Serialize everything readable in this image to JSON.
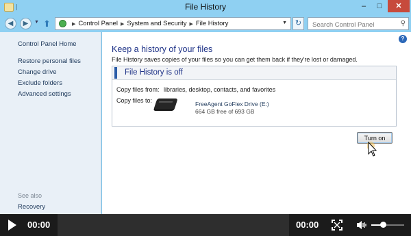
{
  "window": {
    "title": "File History",
    "controls": {
      "minimize": "–",
      "maximize": "□",
      "close": "✕"
    }
  },
  "nav": {
    "breadcrumbs": [
      "Control Panel",
      "System and Security",
      "File History"
    ],
    "search_placeholder": "Search Control Panel"
  },
  "sidebar": {
    "home": "Control Panel Home",
    "links": [
      "Restore personal files",
      "Change drive",
      "Exclude folders",
      "Advanced settings"
    ],
    "see_also_label": "See also",
    "see_also_links": [
      "Recovery"
    ]
  },
  "main": {
    "heading": "Keep a history of your files",
    "description": "File History saves copies of your files so you can get them back if they're lost or damaged.",
    "status": "File History is off",
    "copy_from_label": "Copy files from:",
    "copy_from_value": "libraries, desktop, contacts, and favorites",
    "copy_to_label": "Copy files to:",
    "drive_name": "FreeAgent GoFlex Drive (E:)",
    "drive_space": "664 GB free of 693 GB",
    "turn_on_label": "Turn on"
  },
  "player": {
    "current_time": "00:00",
    "duration": "00:00",
    "progress_fraction": 0,
    "volume_fraction": 0.3
  },
  "colors": {
    "titlebar": "#8fd0f2",
    "heading": "#1e3287",
    "link": "#1e395b",
    "player_bg": "#1b1b1b"
  }
}
